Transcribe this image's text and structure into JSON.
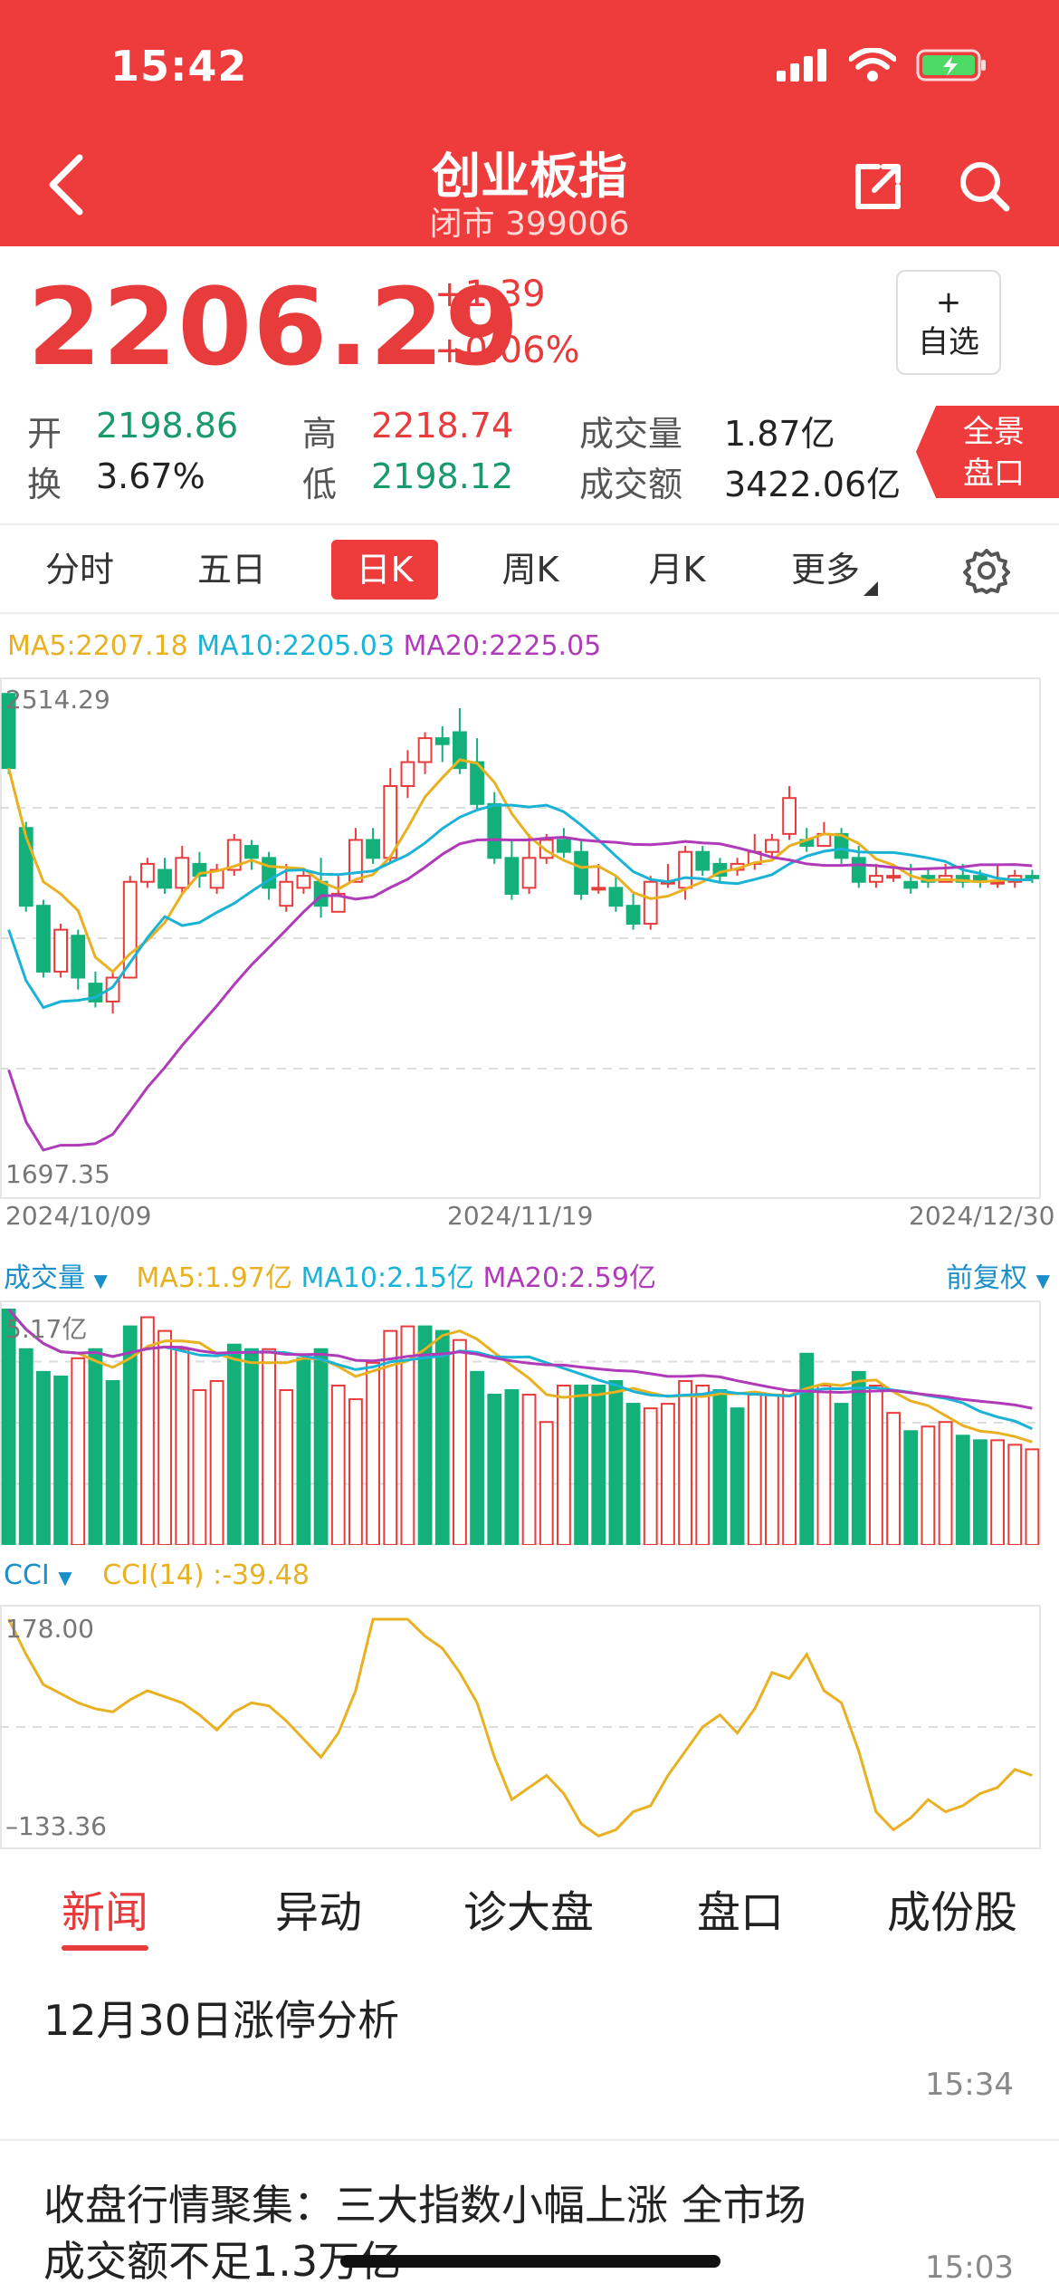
{
  "status_bar": {
    "time": "15:42"
  },
  "nav": {
    "title": "创业板指",
    "subtitle": "闭市 399006"
  },
  "quote": {
    "price": "2206.29",
    "change": "+1.39",
    "change_pct": "+0.06%",
    "watch_label_1": "+",
    "watch_label_2": "自选",
    "open_label": "开",
    "open": "2198.86",
    "high_label": "高",
    "high": "2218.74",
    "volume_label": "成交量",
    "volume": "1.87亿",
    "turnover_label": "换",
    "turnover": "3.67%",
    "low_label": "低",
    "low": "2198.12",
    "amount_label": "成交额",
    "amount": "3422.06亿",
    "full_btn_1": "全景",
    "full_btn_2": "盘口"
  },
  "tabs": [
    "分时",
    "五日",
    "日K",
    "周K",
    "月K",
    "更多"
  ],
  "active_tab": "日K",
  "ma_legend": {
    "ma5": "MA5:2207.18",
    "ma10": "MA10:2205.03",
    "ma20": "MA20:2225.05"
  },
  "kline_axis": {
    "top": "2514.29",
    "bottom": "1697.35",
    "dates": [
      "2024/10/09",
      "2024/11/19",
      "2024/12/30"
    ]
  },
  "volume_legend": {
    "label": "成交量",
    "ma5": "MA5:1.97亿",
    "ma10": "MA10:2.15亿",
    "ma20": "MA20:2.59亿",
    "fq": "前复权",
    "top": "5.17亿"
  },
  "cci_legend": {
    "label": "CCI",
    "value": "CCI(14) :-39.48",
    "top": "178.00",
    "bottom": "–133.36"
  },
  "colors": {
    "up": "#e83b3b",
    "down": "#13b07a",
    "ma5": "#e9b121",
    "ma10": "#1ab3d6",
    "ma20": "#b03bb8"
  },
  "chart_data": [
    {
      "type": "candlestick",
      "title": "日K",
      "ylim": [
        1697.35,
        2514.29
      ],
      "x": [
        "2024/10/09",
        "2024/11/19",
        "2024/12/30"
      ],
      "candles": [
        [
          2514,
          2390,
          2514,
          2380
        ],
        [
          2290,
          2160,
          2300,
          2150
        ],
        [
          2160,
          2050,
          2170,
          2040
        ],
        [
          2050,
          2120,
          2130,
          2040
        ],
        [
          2110,
          2040,
          2120,
          2020
        ],
        [
          2030,
          2000,
          2050,
          1990
        ],
        [
          2000,
          2040,
          2050,
          1980
        ],
        [
          2040,
          2200,
          2210,
          2040
        ],
        [
          2200,
          2230,
          2240,
          2190
        ],
        [
          2220,
          2190,
          2240,
          2180
        ],
        [
          2190,
          2240,
          2260,
          2180
        ],
        [
          2230,
          2210,
          2250,
          2190
        ],
        [
          2190,
          2220,
          2230,
          2180
        ],
        [
          2220,
          2270,
          2280,
          2210
        ],
        [
          2260,
          2240,
          2270,
          2220
        ],
        [
          2240,
          2190,
          2250,
          2170
        ],
        [
          2160,
          2200,
          2230,
          2150
        ],
        [
          2190,
          2210,
          2220,
          2180
        ],
        [
          2200,
          2160,
          2240,
          2140
        ],
        [
          2150,
          2180,
          2210,
          2150
        ],
        [
          2200,
          2270,
          2290,
          2200
        ],
        [
          2270,
          2240,
          2290,
          2230
        ],
        [
          2240,
          2360,
          2390,
          2230
        ],
        [
          2360,
          2400,
          2420,
          2340
        ],
        [
          2400,
          2440,
          2450,
          2380
        ],
        [
          2440,
          2430,
          2460,
          2400
        ],
        [
          2450,
          2390,
          2490,
          2380
        ],
        [
          2400,
          2330,
          2440,
          2320
        ],
        [
          2330,
          2240,
          2350,
          2230
        ],
        [
          2240,
          2180,
          2270,
          2170
        ],
        [
          2190,
          2240,
          2280,
          2180
        ],
        [
          2240,
          2270,
          2280,
          2230
        ],
        [
          2270,
          2250,
          2290,
          2240
        ],
        [
          2250,
          2180,
          2270,
          2170
        ],
        [
          2190,
          2190,
          2230,
          2180
        ],
        [
          2190,
          2160,
          2210,
          2150
        ],
        [
          2160,
          2130,
          2180,
          2120
        ],
        [
          2130,
          2200,
          2210,
          2120
        ],
        [
          2200,
          2200,
          2230,
          2190
        ],
        [
          2190,
          2250,
          2260,
          2170
        ],
        [
          2250,
          2220,
          2260,
          2210
        ],
        [
          2230,
          2210,
          2240,
          2200
        ],
        [
          2220,
          2230,
          2240,
          2210
        ],
        [
          2230,
          2250,
          2280,
          2220
        ],
        [
          2250,
          2270,
          2280,
          2240
        ],
        [
          2280,
          2340,
          2360,
          2270
        ],
        [
          2270,
          2260,
          2290,
          2250
        ],
        [
          2260,
          2280,
          2300,
          2260
        ],
        [
          2280,
          2240,
          2290,
          2230
        ],
        [
          2240,
          2200,
          2260,
          2190
        ],
        [
          2200,
          2210,
          2230,
          2190
        ],
        [
          2210,
          2210,
          2230,
          2200
        ],
        [
          2200,
          2190,
          2230,
          2180
        ],
        [
          2210,
          2200,
          2220,
          2190
        ],
        [
          2200,
          2210,
          2230,
          2200
        ],
        [
          2210,
          2200,
          2230,
          2190
        ],
        [
          2210,
          2200,
          2220,
          2190
        ],
        [
          2200,
          2200,
          2230,
          2190
        ],
        [
          2200,
          2210,
          2220,
          2190
        ],
        [
          2210,
          2206,
          2220,
          2198
        ]
      ]
    },
    {
      "type": "bar",
      "title": "成交量",
      "unit": "亿",
      "ylim": [
        0,
        5.17
      ],
      "values": [
        5.17,
        4.3,
        3.8,
        3.7,
        4.1,
        4.3,
        3.6,
        4.8,
        5.0,
        4.7,
        4.3,
        3.4,
        3.6,
        4.4,
        4.3,
        4.3,
        3.4,
        4.1,
        4.3,
        3.5,
        3.2,
        4.0,
        4.7,
        4.8,
        4.8,
        4.7,
        4.5,
        3.8,
        3.3,
        3.4,
        3.3,
        2.7,
        3.5,
        3.5,
        3.5,
        3.6,
        3.1,
        3.0,
        3.1,
        3.6,
        3.5,
        3.4,
        3.0,
        3.3,
        3.3,
        3.4,
        4.2,
        3.5,
        3.1,
        3.8,
        3.5,
        2.9,
        2.5,
        2.6,
        2.7,
        2.4,
        2.3,
        2.3,
        2.2,
        2.1
      ],
      "up": [
        0,
        0,
        0,
        0,
        1,
        0,
        0,
        0,
        1,
        1,
        1,
        1,
        1,
        0,
        0,
        1,
        1,
        0,
        0,
        1,
        1,
        1,
        1,
        1,
        0,
        0,
        1,
        0,
        0,
        0,
        1,
        1,
        1,
        0,
        0,
        0,
        0,
        1,
        1,
        1,
        1,
        0,
        0,
        1,
        1,
        1,
        0,
        1,
        0,
        0,
        1,
        1,
        0,
        1,
        1,
        0,
        0,
        1,
        1,
        1
      ]
    },
    {
      "type": "line",
      "title": "CCI(14)",
      "ylim": [
        -133.36,
        178.0
      ],
      "values": [
        178,
        120,
        70,
        55,
        40,
        30,
        25,
        45,
        60,
        50,
        40,
        20,
        -5,
        25,
        40,
        35,
        10,
        -20,
        -50,
        -10,
        60,
        178,
        178,
        178,
        150,
        130,
        90,
        40,
        -50,
        -120,
        -100,
        -80,
        -110,
        -160,
        -180,
        -170,
        -140,
        -130,
        -80,
        -40,
        0,
        20,
        -10,
        30,
        90,
        80,
        120,
        60,
        40,
        -40,
        -140,
        -170,
        -150,
        -120,
        -140,
        -130,
        -110,
        -100,
        -70,
        -80
      ]
    }
  ]
}
